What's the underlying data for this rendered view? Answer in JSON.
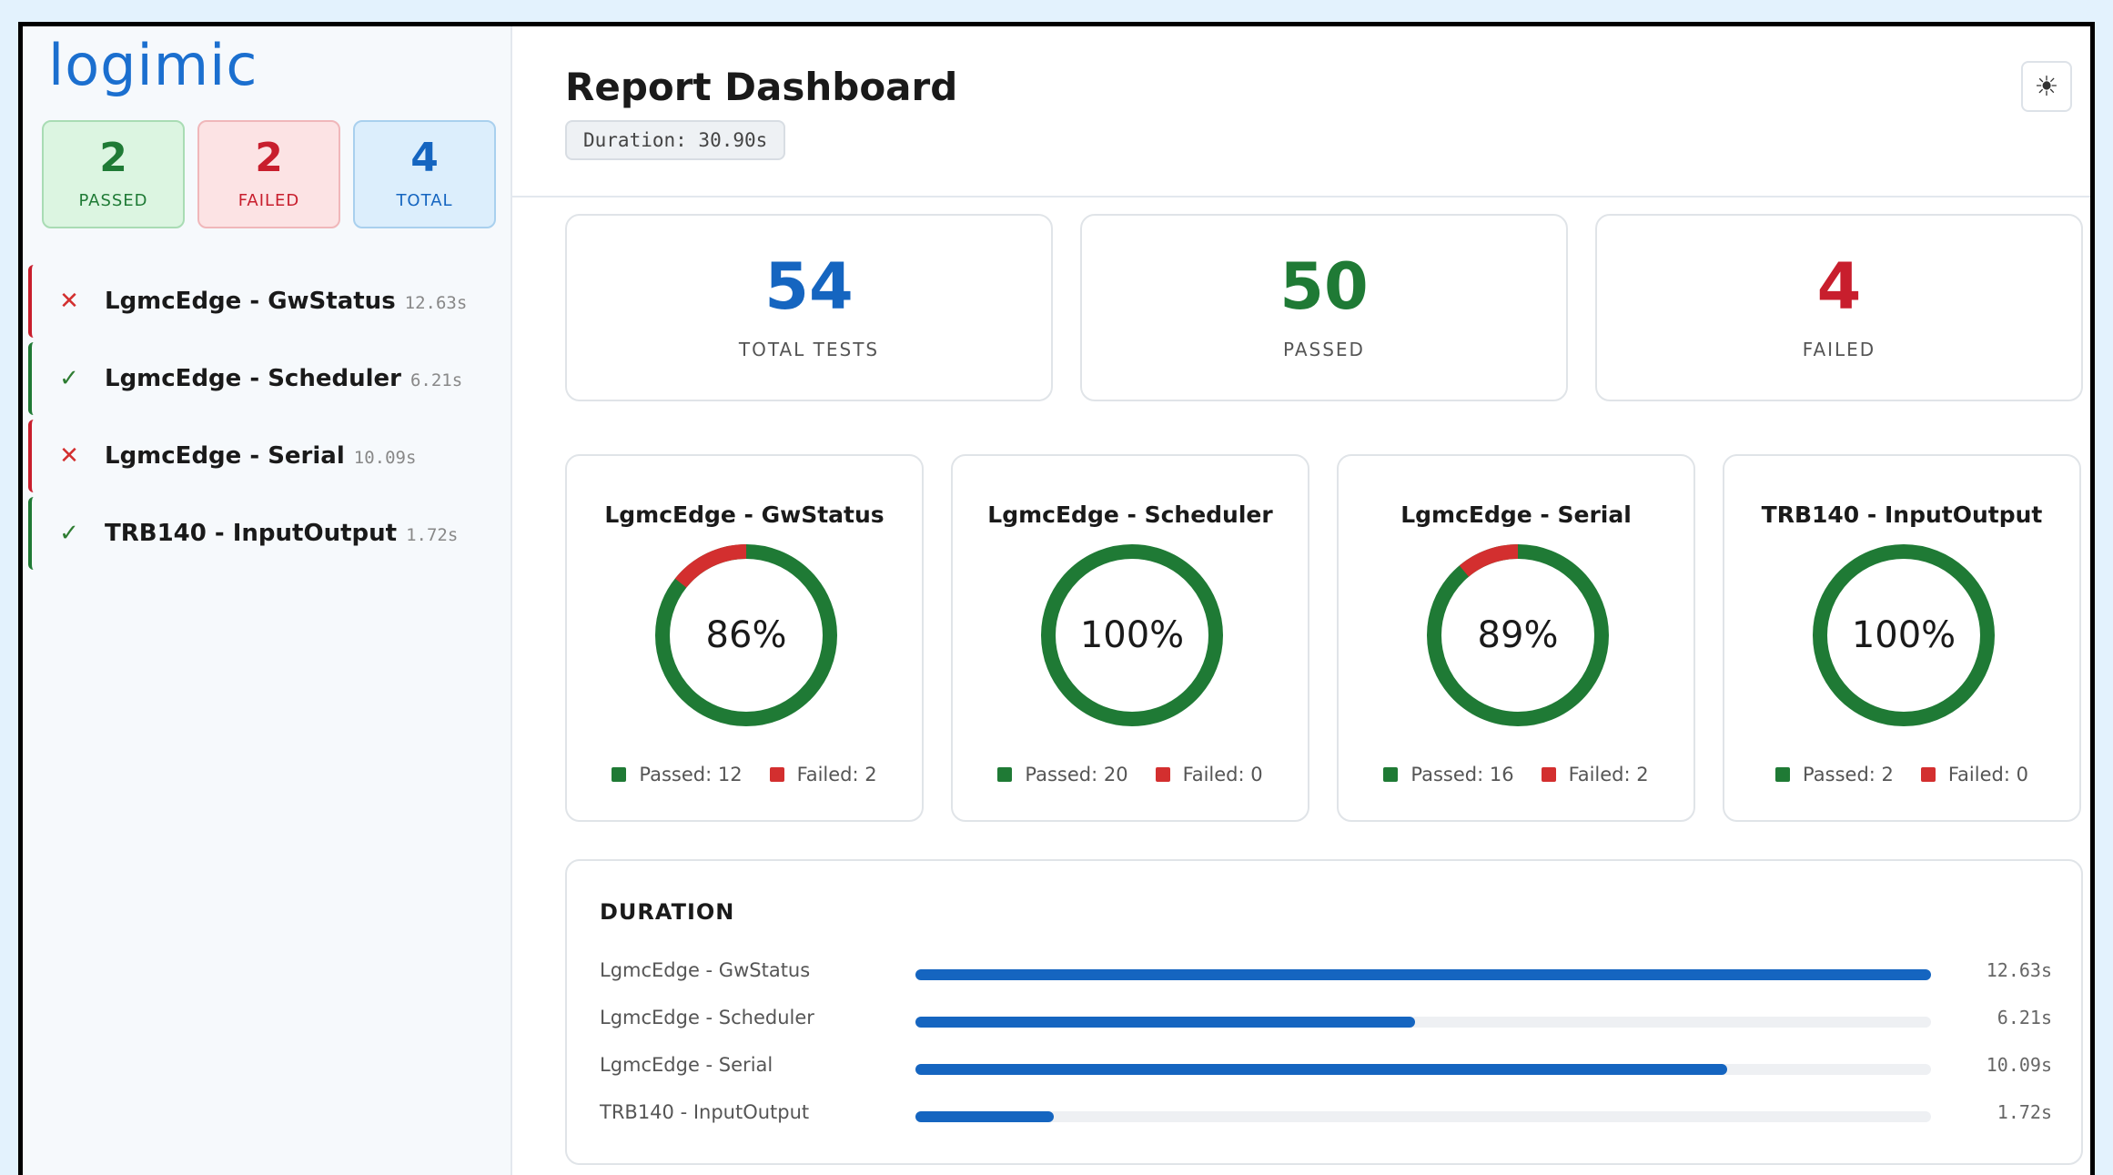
{
  "brand": {
    "logo": "logimic"
  },
  "sidebar": {
    "stats": [
      {
        "value": "2",
        "label": "PASSED"
      },
      {
        "value": "2",
        "label": "FAILED"
      },
      {
        "value": "4",
        "label": "TOTAL"
      }
    ],
    "suites": [
      {
        "status": "failed",
        "icon": "x-icon",
        "glyph": "✕",
        "name": "LgmcEdge - GwStatus",
        "time": "12.63s"
      },
      {
        "status": "passed",
        "icon": "check-icon",
        "glyph": "✓",
        "name": "LgmcEdge - Scheduler",
        "time": "6.21s"
      },
      {
        "status": "failed",
        "icon": "x-icon",
        "glyph": "✕",
        "name": "LgmcEdge - Serial",
        "time": "10.09s"
      },
      {
        "status": "passed",
        "icon": "check-icon",
        "glyph": "✓",
        "name": "TRB140 - InputOutput",
        "time": "1.72s"
      }
    ]
  },
  "header": {
    "title": "Report Dashboard",
    "duration": "Duration: 30.90s",
    "theme_icon": "sun-icon",
    "theme_glyph": "☀"
  },
  "summary": [
    {
      "value": "54",
      "label": "TOTAL TESTS",
      "color": "#1565c0"
    },
    {
      "value": "50",
      "label": "PASSED",
      "color": "#1f7a35"
    },
    {
      "value": "4",
      "label": "FAILED",
      "color": "#c81e2d"
    }
  ],
  "donuts": [
    {
      "title": "LgmcEdge - GwStatus",
      "percent": "86%",
      "passed": 12,
      "failed": 2,
      "passed_label": "Passed: 12",
      "failed_label": "Failed: 2"
    },
    {
      "title": "LgmcEdge - Scheduler",
      "percent": "100%",
      "passed": 20,
      "failed": 0,
      "passed_label": "Passed: 20",
      "failed_label": "Failed: 0"
    },
    {
      "title": "LgmcEdge - Serial",
      "percent": "89%",
      "passed": 16,
      "failed": 2,
      "passed_label": "Passed: 16",
      "failed_label": "Failed: 2"
    },
    {
      "title": "TRB140 - InputOutput",
      "percent": "100%",
      "passed": 2,
      "failed": 0,
      "passed_label": "Passed: 2",
      "failed_label": "Failed: 0"
    }
  ],
  "duration_chart": {
    "title": "DURATION",
    "max_seconds": 12.63,
    "rows": [
      {
        "label": "LgmcEdge - GwStatus",
        "seconds": 12.63,
        "text": "12.63s"
      },
      {
        "label": "LgmcEdge - Scheduler",
        "seconds": 6.21,
        "text": "6.21s"
      },
      {
        "label": "LgmcEdge - Serial",
        "seconds": 10.09,
        "text": "10.09s"
      },
      {
        "label": "TRB140 - InputOutput",
        "seconds": 1.72,
        "text": "1.72s"
      }
    ]
  },
  "colors": {
    "passed": "#1f7a35",
    "failed": "#d32f2f",
    "accent": "#1565c0"
  }
}
